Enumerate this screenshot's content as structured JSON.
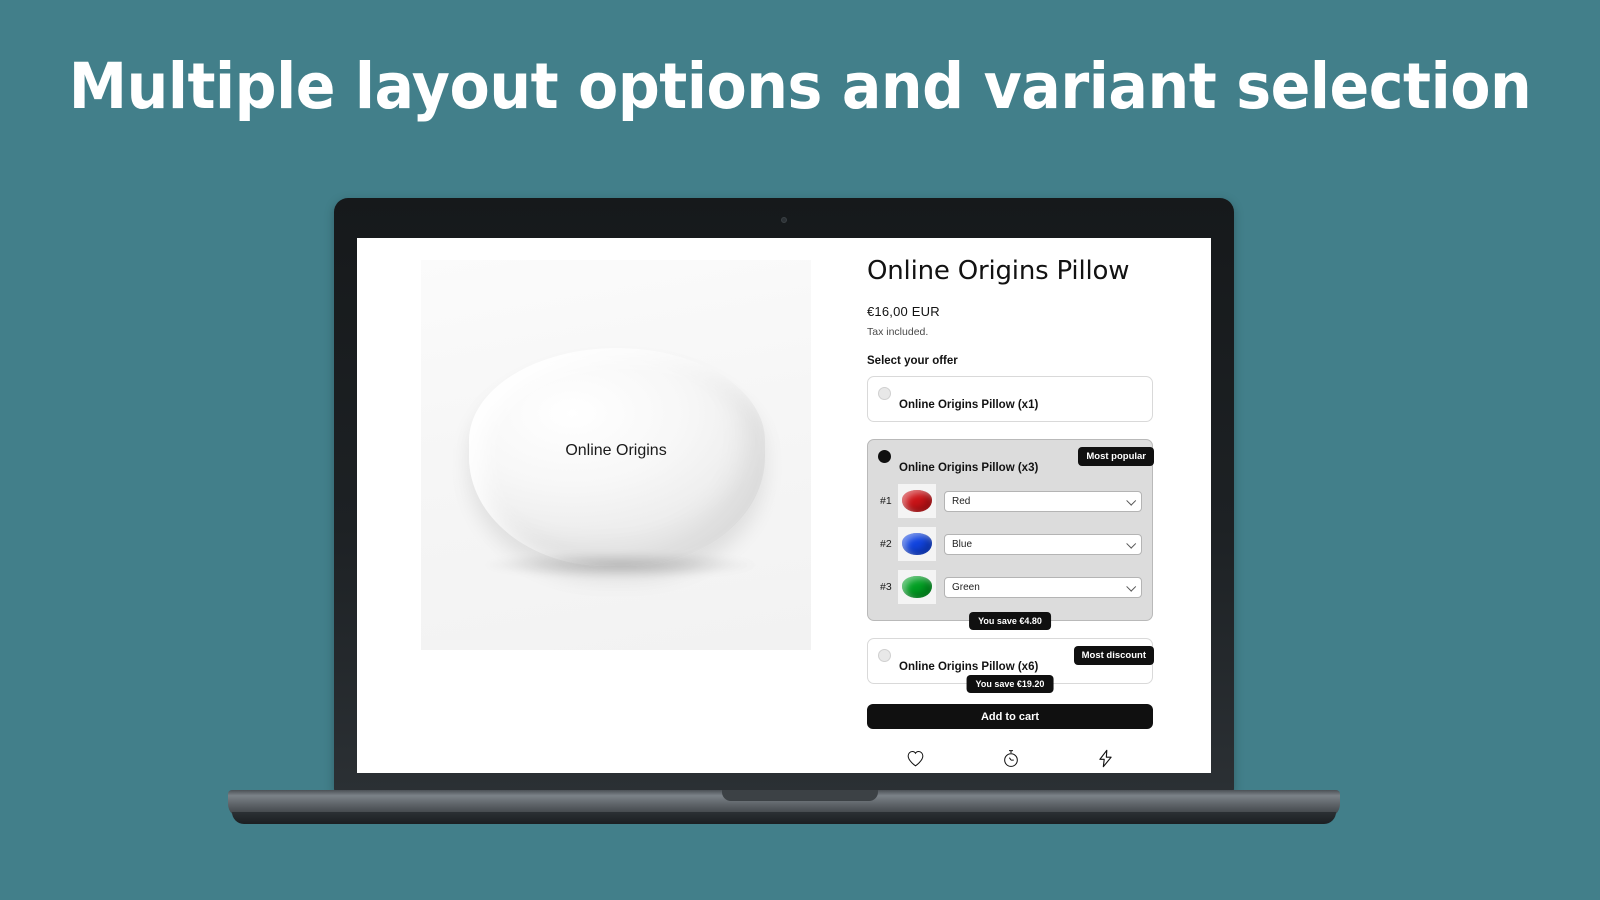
{
  "headline": "Multiple layout options and variant selection",
  "theme": {
    "background": "#427f8a",
    "accent": "#101010",
    "selected_offer_bg": "#dcdcdc"
  },
  "product": {
    "title": "Online Origins Pillow",
    "price": "€16,00 EUR",
    "tax_note": "Tax included.",
    "image_label": "Online Origins"
  },
  "offer_section": {
    "label": "Select your offer",
    "offers": [
      {
        "name": "Online Origins Pillow (x1)",
        "selected": false,
        "badge": null,
        "save_badge": null,
        "variants": []
      },
      {
        "name": "Online Origins Pillow (x3)",
        "selected": true,
        "badge": "Most popular",
        "save_badge": "You save €4.80",
        "variants": [
          {
            "index": "#1",
            "value": "Red",
            "color": "#cc1418"
          },
          {
            "index": "#2",
            "value": "Blue",
            "color": "#1144e0"
          },
          {
            "index": "#3",
            "value": "Green",
            "color": "#00a023"
          }
        ]
      },
      {
        "name": "Online Origins Pillow (x6)",
        "selected": false,
        "badge": "Most discount",
        "save_badge": "You save €19.20",
        "variants": []
      }
    ]
  },
  "actions": {
    "add_to_cart": "Add to cart",
    "icons": [
      "heart-icon",
      "stopwatch-icon",
      "lightning-bolt-icon"
    ]
  }
}
